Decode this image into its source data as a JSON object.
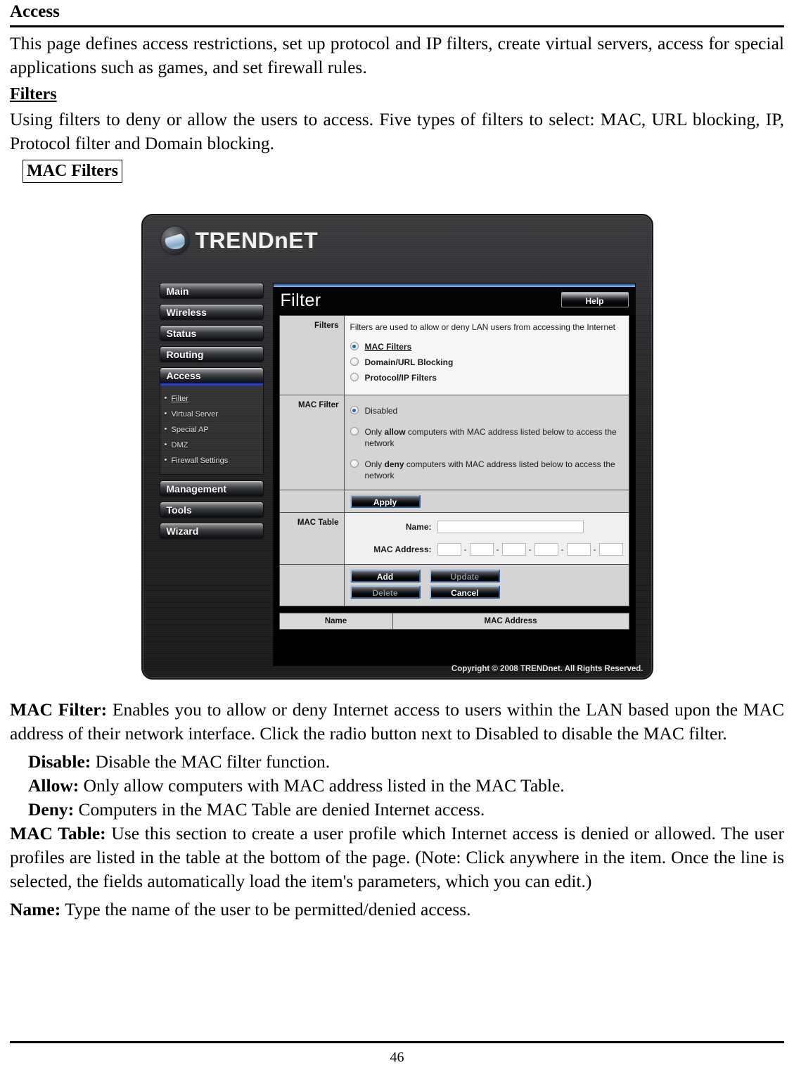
{
  "document": {
    "section_title": "Access",
    "intro_paragraph": "This page defines access restrictions, set up protocol and IP filters, create virtual servers, access for special applications such as games, and set firewall rules.",
    "filters_heading": "Filters",
    "filters_paragraph": "Using filters to deny or allow the users to access.  Five types of filters to select: MAC, URL blocking, IP, Protocol filter and Domain blocking.",
    "boxed_label": "MAC Filters",
    "page_number": "46"
  },
  "screenshot": {
    "brand": "TRENDnET",
    "brand_text": "TRENDnET",
    "nav": [
      {
        "label": "Main",
        "active": false
      },
      {
        "label": "Wireless",
        "active": false
      },
      {
        "label": "Status",
        "active": false
      },
      {
        "label": "Routing",
        "active": false
      },
      {
        "label": "Access",
        "active": true
      },
      {
        "label": "Management",
        "active": false
      },
      {
        "label": "Tools",
        "active": false
      },
      {
        "label": "Wizard",
        "active": false
      }
    ],
    "submenu": [
      {
        "label": "Filter",
        "current": true
      },
      {
        "label": "Virtual Server",
        "current": false
      },
      {
        "label": "Special AP",
        "current": false
      },
      {
        "label": "DMZ",
        "current": false
      },
      {
        "label": "Firewall Settings",
        "current": false
      }
    ],
    "panel": {
      "title": "Filter",
      "help_label": "Help"
    },
    "filters_section": {
      "row_label": "Filters",
      "description": "Filters are used to allow or deny LAN users from accessing the Internet",
      "options": [
        {
          "label": "MAC Filters",
          "checked": true
        },
        {
          "label": "Domain/URL Blocking",
          "checked": false
        },
        {
          "label": "Protocol/IP Filters",
          "checked": false
        }
      ]
    },
    "mac_filter_section": {
      "row_label": "MAC Filter",
      "options": [
        {
          "pre": "Disabled",
          "em": "",
          "post": "",
          "checked": true
        },
        {
          "pre": "Only ",
          "em": "allow",
          "post": " computers with MAC address listed below to access the network",
          "checked": false
        },
        {
          "pre": "Only ",
          "em": "deny",
          "post": " computers with MAC address listed below to access the network",
          "checked": false
        }
      ],
      "apply_label": "Apply"
    },
    "mac_table_section": {
      "row_label": "MAC Table",
      "name_label": "Name:",
      "name_value": "",
      "mac_label": "MAC Address:",
      "mac_octets": [
        "",
        "",
        "",
        "",
        "",
        ""
      ],
      "separator": "-",
      "buttons": [
        {
          "label": "Add",
          "disabled": false
        },
        {
          "label": "Update",
          "disabled": true
        },
        {
          "label": "Delete",
          "disabled": true
        },
        {
          "label": "Cancel",
          "disabled": false
        }
      ]
    },
    "result_table": {
      "columns": [
        "Name",
        "MAC Address"
      ]
    },
    "copyright": "Copyright © 2008 TRENDnet. All Rights Reserved.",
    "colors": {
      "accent_blue": "#1d3fe8",
      "title_bar_gradient_blue": "#3a76c9",
      "radio_dot": "#1869b8",
      "panel_bg": "#000000",
      "label_cell_bg": "#d4d4d4"
    }
  },
  "descriptions": {
    "mac_filter": {
      "term": "MAC Filter:",
      "text": " Enables you to allow or deny Internet access to users within the LAN based upon the MAC address of their network interface. Click the radio button next to Disabled to disable the MAC filter."
    },
    "disable": {
      "term": "Disable:",
      "text": " Disable the MAC filter function."
    },
    "allow": {
      "term": "Allow:",
      "text": " Only allow computers with MAC address listed in the MAC Table."
    },
    "deny": {
      "term": "Deny:",
      "text": " Computers in the MAC Table are denied Internet access."
    },
    "mac_table": {
      "term": "MAC Table:",
      "text": " Use this section to create a user profile which Internet access is denied or allowed.  The user profiles are listed in the table at the bottom of the page.  (Note: Click anywhere in the item. Once the line is selected, the fields automatically load the item's parameters, which you can edit.)"
    },
    "name": {
      "term": "Name:",
      "text": " Type the name of the user to be permitted/denied access."
    }
  }
}
